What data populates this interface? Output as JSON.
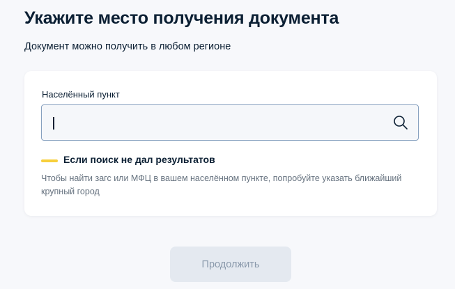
{
  "header": {
    "title": "Укажите место получения документа",
    "subtitle": "Документ можно получить в любом регионе"
  },
  "form": {
    "locality_label": "Населённый пункт",
    "locality_value": "",
    "search_icon": "search-icon"
  },
  "hint": {
    "title": "Если поиск не дал результатов",
    "text": "Чтобы найти загс или МФЦ в вашем населённом пункте, попробуйте указать ближайший крупный город",
    "marker_color": "#f7cf3c"
  },
  "actions": {
    "continue_label": "Продолжить"
  },
  "colors": {
    "accent_border": "#86a0bf",
    "text_primary": "#0b1f33",
    "text_secondary": "#66727f",
    "button_disabled_bg": "#e4e9f0"
  }
}
